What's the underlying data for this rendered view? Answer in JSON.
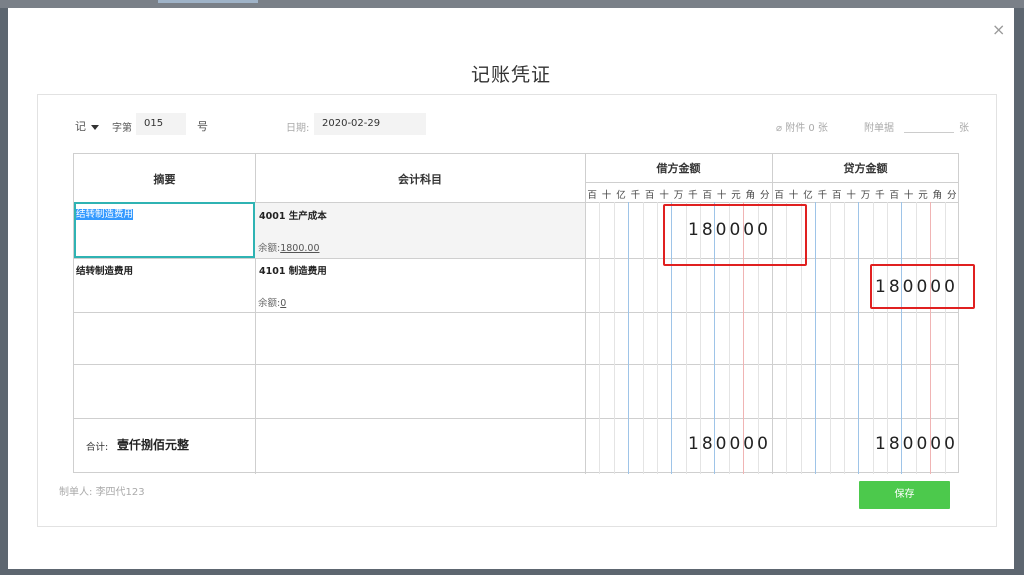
{
  "dialog": {
    "title": "记账凭证",
    "close_glyph": "×"
  },
  "header": {
    "voucher_word": "记",
    "word_label": "字第",
    "number": "015",
    "number_suffix": "号",
    "date_label": "日期:",
    "date_value": "2020-02-29",
    "attachment_label": "附件 0 张",
    "bill_label": "附单据",
    "bill_unit": "张"
  },
  "table": {
    "col_summary": "摘要",
    "col_account": "会计科目",
    "col_debit": "借方金额",
    "col_credit": "贷方金额",
    "digit_units": [
      "百",
      "十",
      "亿",
      "千",
      "百",
      "十",
      "万",
      "千",
      "百",
      "十",
      "元",
      "角",
      "分"
    ],
    "balance_label": "余额:",
    "rows": [
      {
        "summary": "结转制造费用",
        "account": "4001 生产成本",
        "balance": "1800.00",
        "debit": "180000",
        "credit": ""
      },
      {
        "summary": "结转制造费用",
        "account": "4101 制造费用",
        "balance": "0",
        "debit": "",
        "credit": "180000"
      }
    ],
    "total_label": "合计:",
    "total_words": "壹仟捌佰元整",
    "total_debit": "180000",
    "total_credit": "180000"
  },
  "footer": {
    "maker_label": "制单人:",
    "maker_name": "李四代123",
    "save_label": "保存"
  }
}
